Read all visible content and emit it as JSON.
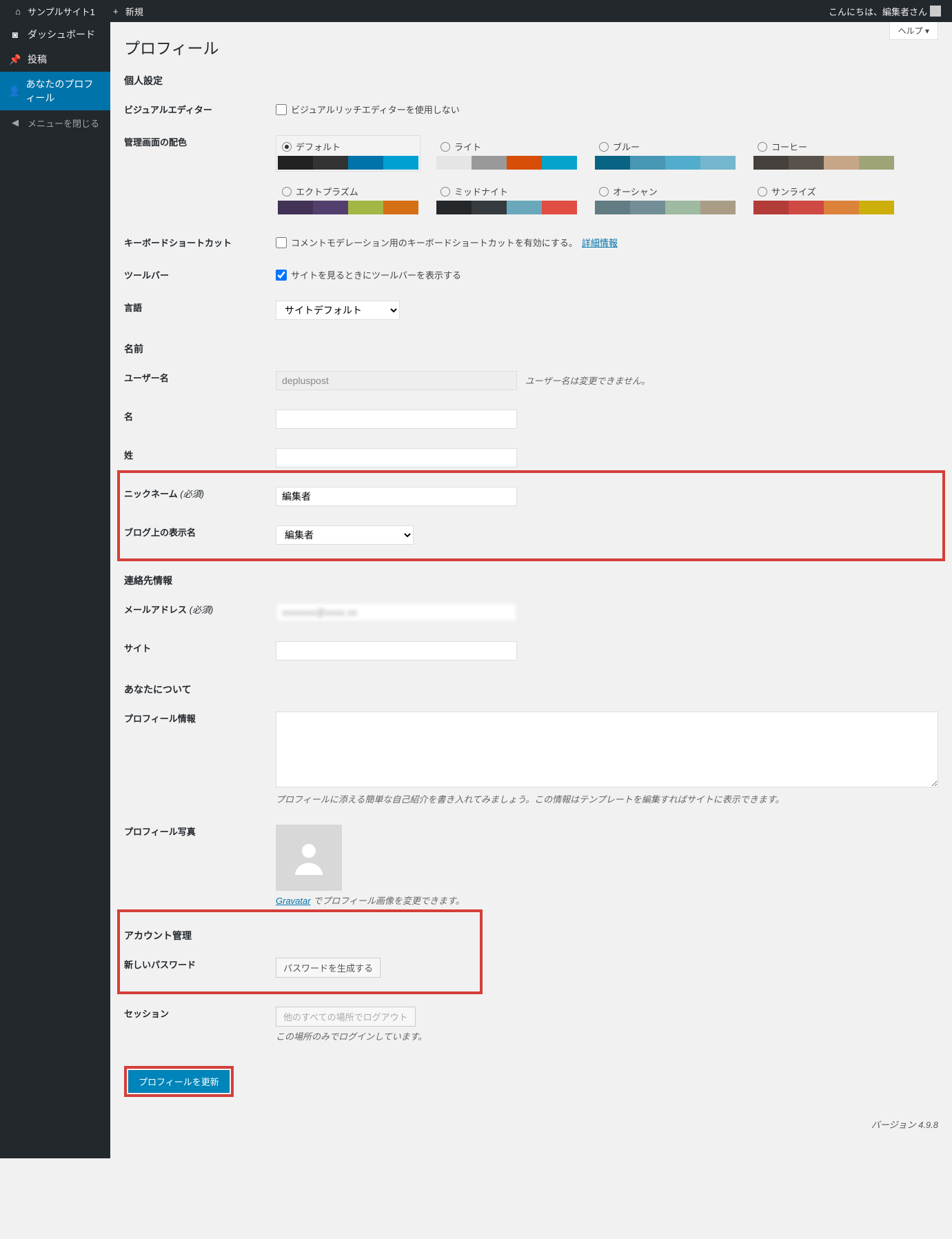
{
  "adminbar": {
    "site": "サンプルサイト1",
    "new": "新規",
    "greeting": "こんにちは、編集者さん"
  },
  "sidebar": {
    "dashboard": "ダッシュボード",
    "posts": "投稿",
    "profile": "あなたのプロフィール",
    "collapse": "メニューを閉じる"
  },
  "help": "ヘルプ ▾",
  "page_title": "プロフィール",
  "sections": {
    "personal": "個人設定",
    "name": "名前",
    "contact": "連絡先情報",
    "about": "あなたについて",
    "account": "アカウント管理"
  },
  "rows": {
    "visual_editor": {
      "label": "ビジュアルエディター",
      "check": "ビジュアルリッチエディターを使用しない"
    },
    "color_scheme": {
      "label": "管理画面の配色"
    },
    "keyboard": {
      "label": "キーボードショートカット",
      "check": "コメントモデレーション用のキーボードショートカットを有効にする。",
      "link": "詳細情報"
    },
    "toolbar": {
      "label": "ツールバー",
      "check": "サイトを見るときにツールバーを表示する"
    },
    "language": {
      "label": "言語",
      "value": "サイトデフォルト"
    },
    "username": {
      "label": "ユーザー名",
      "value": "depluspost",
      "desc": "ユーザー名は変更できません。"
    },
    "first_name": {
      "label": "名"
    },
    "last_name": {
      "label": "姓"
    },
    "nickname": {
      "label": "ニックネーム ",
      "req": "(必須)",
      "value": "編集者"
    },
    "display": {
      "label": "ブログ上の表示名",
      "value": "編集者"
    },
    "email": {
      "label": "メールアドレス ",
      "req": "(必須)"
    },
    "website": {
      "label": "サイト"
    },
    "bio": {
      "label": "プロフィール情報",
      "desc": "プロフィールに添える簡単な自己紹介を書き入れてみましょう。この情報はテンプレートを編集すればサイトに表示できます。"
    },
    "photo": {
      "label": "プロフィール写真",
      "link": "Gravatar",
      "desc": " でプロフィール画像を変更できます。"
    },
    "password": {
      "label": "新しいパスワード",
      "button": "パスワードを生成する"
    },
    "sessions": {
      "label": "セッション",
      "button": "他のすべての場所でログアウト",
      "desc": "この場所のみでログインしています。"
    }
  },
  "schemes": [
    {
      "name": "デフォルト",
      "colors": [
        "#222",
        "#333",
        "#0073aa",
        "#00a0d2"
      ],
      "selected": true
    },
    {
      "name": "ライト",
      "colors": [
        "#e5e5e5",
        "#999",
        "#d64e07",
        "#04a4cc"
      ]
    },
    {
      "name": "ブルー",
      "colors": [
        "#096484",
        "#4796b3",
        "#52accc",
        "#74b6ce"
      ]
    },
    {
      "name": "コーヒー",
      "colors": [
        "#46403c",
        "#59524c",
        "#c7a589",
        "#9ea476"
      ]
    },
    {
      "name": "エクトプラズム",
      "colors": [
        "#413256",
        "#523f6d",
        "#a3b745",
        "#d46f15"
      ]
    },
    {
      "name": "ミッドナイト",
      "colors": [
        "#25282b",
        "#363b3f",
        "#69a8bb",
        "#e14d43"
      ]
    },
    {
      "name": "オーシャン",
      "colors": [
        "#627c83",
        "#738e96",
        "#9ebaa0",
        "#aa9d88"
      ]
    },
    {
      "name": "サンライズ",
      "colors": [
        "#b43c38",
        "#cf4944",
        "#dd823b",
        "#ccaf0b"
      ]
    }
  ],
  "submit": "プロフィールを更新",
  "footer": "バージョン 4.9.8"
}
